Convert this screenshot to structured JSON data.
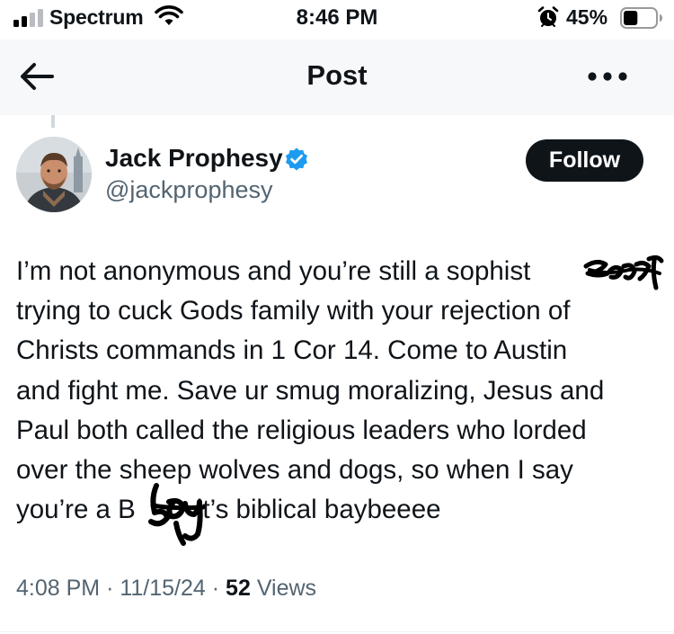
{
  "status_bar": {
    "carrier": "Spectrum",
    "time": "8:46 PM",
    "battery_percent": "45%",
    "battery_level": 0.45
  },
  "nav": {
    "back_icon": "arrow-left-icon",
    "title": "Post",
    "more_icon": "more-horizontal-icon"
  },
  "post": {
    "author": {
      "name": "Jack Prophesy",
      "handle": "@jackprophesy",
      "verified": true,
      "verified_color": "#1d9bf0"
    },
    "follow_label": "Follow",
    "text_lines": [
      "I’m not anonymous and you’re still a sophist",
      "trying to cuck Gods family with your rejection of",
      "Christs commands in 1 Cor 14. Come to Austin",
      "and fight me. Save ur smug moralizing, Jesus and",
      "Paul both called the religious leaders who lorded",
      "over the sheep wolves and dogs, so when I say",
      "you’re a B",
      "it’s biblical baybeeee"
    ],
    "time": "4:08 PM",
    "date": "11/15/24",
    "separator": "·",
    "views_count": "52",
    "views_label": "Views"
  },
  "colors": {
    "text": "#0f1419",
    "secondary": "#536471",
    "verified": "#1d9bf0",
    "follow_bg": "#0f1419",
    "nav_bg": "#f7f8f9"
  }
}
